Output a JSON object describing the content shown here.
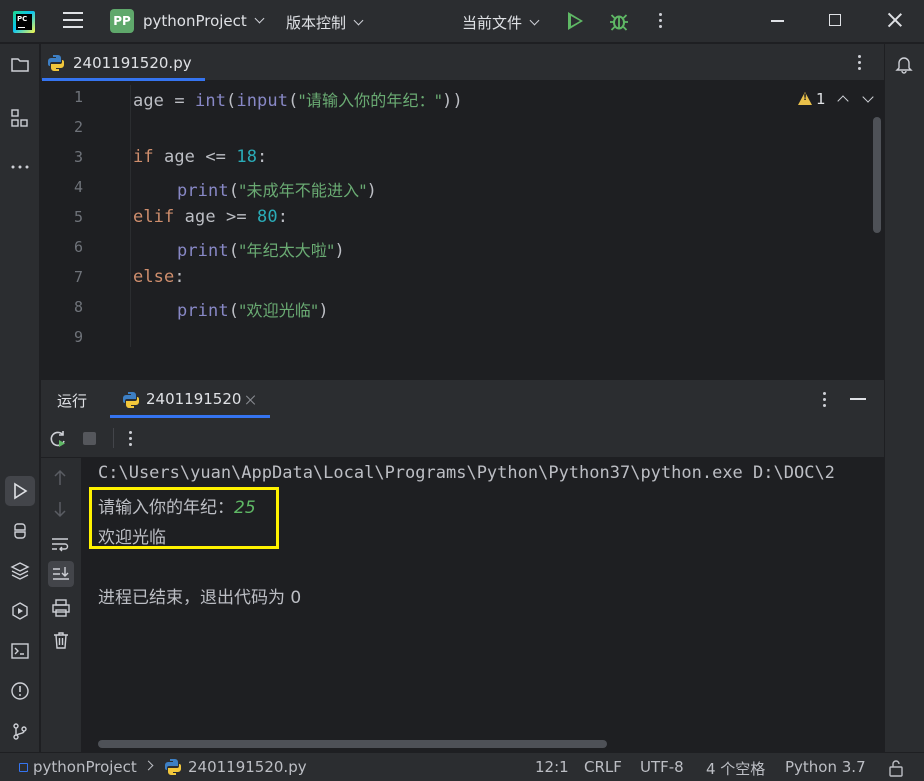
{
  "titlebar": {
    "project_badge": "PP",
    "project_name": "pythonProject",
    "vcs_menu": "版本控制",
    "run_config": "当前文件"
  },
  "editor": {
    "tab_filename": "2401191520.py",
    "warning_count": "1",
    "line_numbers": [
      "1",
      "2",
      "3",
      "4",
      "5",
      "6",
      "7",
      "8",
      "9"
    ],
    "code": {
      "l1_var": "age",
      "l1_op": " = ",
      "l1_int": "int",
      "l1_p1": "(",
      "l1_input": "input",
      "l1_p2": "(",
      "l1_str": "\"请输入你的年纪：\"",
      "l1_p3": "))",
      "l3_kw": "if",
      "l3_rest": " age <= ",
      "l3_num": "18",
      "l3_colon": ":",
      "l4_fn": "print",
      "l4_p1": "(",
      "l4_str": "\"未成年不能进入\"",
      "l4_p2": ")",
      "l5_kw": "elif",
      "l5_rest": " age >= ",
      "l5_num": "80",
      "l5_colon": ":",
      "l6_fn": "print",
      "l6_p1": "(",
      "l6_str": "\"年纪太大啦\"",
      "l6_p2": ")",
      "l7_kw": "else",
      "l7_colon": ":",
      "l8_fn": "print",
      "l8_p1": "(",
      "l8_str": "\"欢迎光临\"",
      "l8_p2": ")"
    }
  },
  "run_panel": {
    "title": "运行",
    "tab_label": "2401191520",
    "console": {
      "command": "C:\\Users\\yuan\\AppData\\Local\\Programs\\Python\\Python37\\python.exe D:\\DOC\\2",
      "prompt": "请输入你的年纪：",
      "user_input": "25",
      "output": "欢迎光临",
      "exit_message": "进程已结束，退出代码为 0"
    }
  },
  "statusbar": {
    "project": "pythonProject",
    "file": "2401191520.py",
    "position": "12:1",
    "line_separator": "CRLF",
    "encoding": "UTF-8",
    "indent": "4 个空格",
    "interpreter": "Python 3.7"
  },
  "colors": {
    "accent": "#3574f0",
    "run_green": "#5fb865",
    "highlight_yellow": "#fff200",
    "keyword": "#cf8e6d",
    "string": "#6aab73",
    "number": "#2aacb8"
  }
}
